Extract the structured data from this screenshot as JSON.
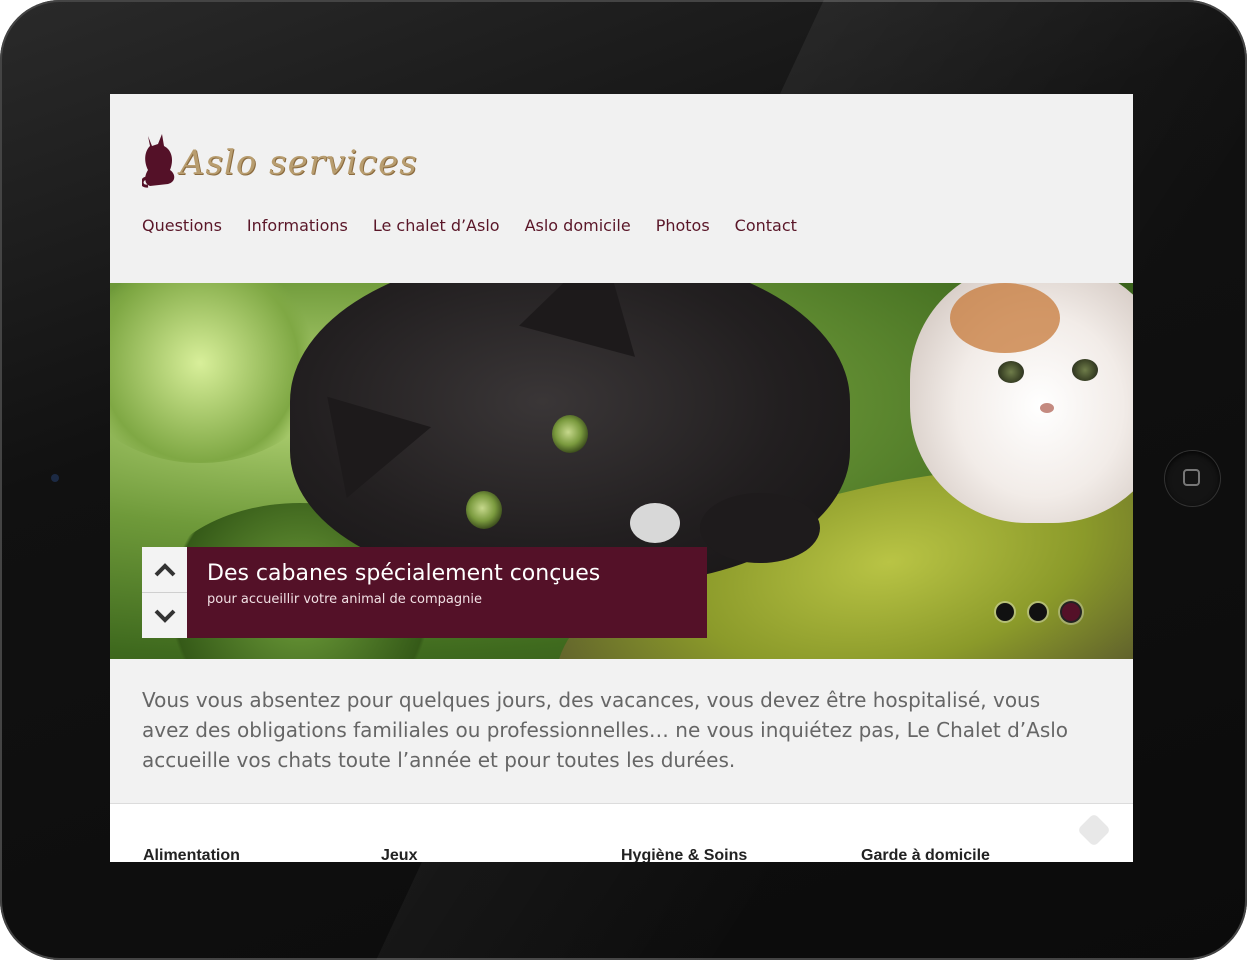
{
  "site": {
    "logo_text": "Aslo services",
    "nav": [
      "Questions",
      "Informations",
      "Le chalet d’Aslo",
      "Aslo domicile",
      "Photos",
      "Contact"
    ]
  },
  "slider": {
    "caption_title": "Des cabanes spécialement conçues",
    "caption_subtitle": "pour accueillir votre animal de compagnie",
    "active_dot": 3,
    "dot_count": 3
  },
  "intro": {
    "text": "Vous vous absentez pour quelques jours, des vacances, vous devez être hospitalisé, vous avez des obligations familiales ou professionnelles… ne vous inquiétez pas, Le Chalet d’Aslo accueille vos chats toute l’année et pour toutes les durées."
  },
  "features": [
    "Alimentation",
    "Jeux",
    "Hygiène & Soins",
    "Garde à domicile"
  ]
}
